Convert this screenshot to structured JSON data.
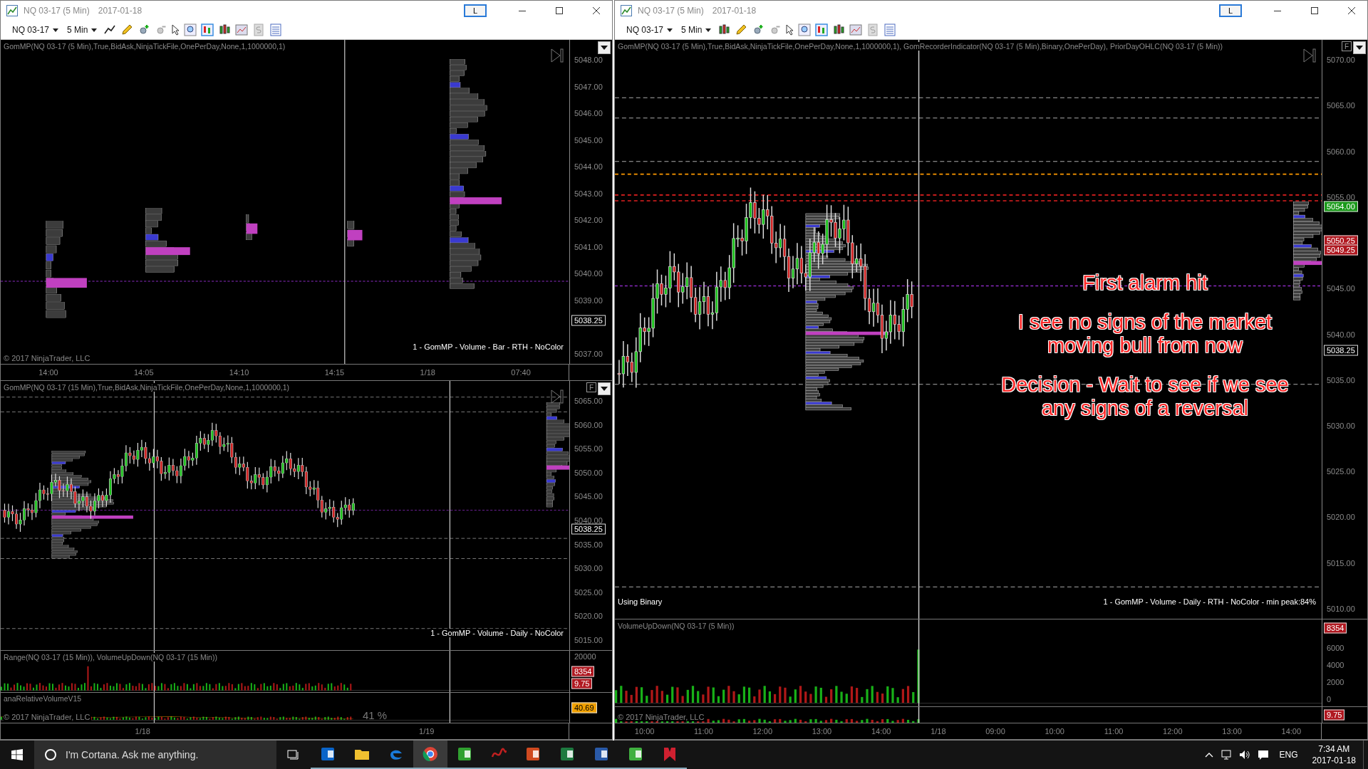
{
  "windows": [
    {
      "title": "NQ 03-17 (5 Min)",
      "date": "2017-01-18",
      "layout_button": "L",
      "toolbar": {
        "instrument": "NQ 03-17",
        "interval": "5 Min"
      },
      "panes": [
        {
          "kind": "profile",
          "label": "GomMP(NQ 03-17 (5 Min),True,BidAsk,NinjaTickFile,OnePerDay,None,1,1000000,1)",
          "legend": "1 - GomMP - Volume - Bar - RTH - NoColor",
          "copyright": "© 2017 NinjaTrader, LLC",
          "axis": [
            "5048.00",
            "5047.00",
            "5046.00",
            "5045.00",
            "5044.00",
            "5043.00",
            "5042.00",
            "5041.00",
            "5040.00",
            "5039.00",
            "5037.00"
          ],
          "markers": [
            {
              "value": "5038.25",
              "color": "#000000"
            }
          ]
        },
        {
          "kind": "time",
          "labels": [
            "14:00",
            "14:05",
            "14:10",
            "14:15",
            "1/18",
            "07:40"
          ]
        },
        {
          "kind": "price",
          "label": "GomMP(NQ 03-17 (15 Min),True,BidAsk,NinjaTickFile,OnePerDay,None,1,1000000,1)",
          "legend": "1 - GomMP - Volume - Daily - NoColor",
          "f_button": "F",
          "axis": [
            "5065.00",
            "5060.00",
            "5055.00",
            "5050.00",
            "5045.00",
            "5040.00",
            "5035.00",
            "5030.00",
            "5025.00",
            "5020.00",
            "5015.00"
          ],
          "markers": [
            {
              "value": "5038.25",
              "color": "#000000"
            }
          ]
        },
        {
          "kind": "volume",
          "label": "Range(NQ 03-17 (15 Min)), VolumeUpDown(NQ 03-17 (15 Min))",
          "axis": [
            "20000"
          ],
          "markers": [
            {
              "value": "8354",
              "color": "#b01820"
            },
            {
              "value": "9.75",
              "color": "#b01820"
            }
          ]
        },
        {
          "kind": "relvol",
          "label": "anaRelativeVolumeV15",
          "copyright": "© 2017 NinjaTrader, LLC",
          "percent": "41 %",
          "markers": [
            {
              "value": "40.69",
              "color": "#f0a000"
            }
          ]
        },
        {
          "kind": "time",
          "labels": [
            "1/18",
            "1/19"
          ]
        }
      ]
    },
    {
      "title": "NQ 03-17 (5 Min)",
      "date": "2017-01-18",
      "layout_button": "L",
      "toolbar": {
        "instrument": "NQ 03-17",
        "interval": "5 Min"
      },
      "panes": [
        {
          "kind": "price",
          "label": "GomMP(NQ 03-17 (5 Min),True,BidAsk,NinjaTickFile,OnePerDay,None,1,1000000,1), GomRecorderIndicator(NQ 03-17 (5 Min),Binary,OnePerDay), PriorDayOHLC(NQ 03-17 (5 Min))",
          "legend": "1 - GomMP - Volume - Daily - RTH - NoColor - min peak:84%",
          "note": "Using Binary",
          "f_button": "F",
          "axis": [
            "5070.00",
            "5065.00",
            "5060.00",
            "5055.00",
            "5045.00",
            "5040.00",
            "5035.00",
            "5030.00",
            "5025.00",
            "5020.00",
            "5015.00",
            "5010.00"
          ],
          "markers": [
            {
              "value": "5054.00",
              "color": "#1a9a1a"
            },
            {
              "value": "5050.25",
              "color": "#b01820"
            },
            {
              "value": "5049.25",
              "color": "#b01820"
            },
            {
              "value": "5038.25",
              "color": "#000000"
            }
          ]
        },
        {
          "kind": "volume",
          "label": "VolumeUpDown(NQ 03-17 (5 Min))",
          "axis": [
            "6000",
            "4000",
            "2000",
            "0"
          ],
          "markers": [
            {
              "value": "8354",
              "color": "#b01820"
            }
          ]
        },
        {
          "kind": "range",
          "copyright": "© 2017 NinjaTrader, LLC",
          "markers": [
            {
              "value": "9.75",
              "color": "#b01820"
            }
          ]
        },
        {
          "kind": "time",
          "labels": [
            "10:00",
            "11:00",
            "12:00",
            "13:00",
            "14:00",
            "1/18",
            "09:00",
            "10:00",
            "11:00",
            "12:00",
            "13:00",
            "14:00"
          ]
        }
      ]
    }
  ],
  "annotations": [
    "First alarm hit",
    "I see no signs of the market moving bull from now",
    "Decision - Wait to see if we see any signs of a reversal"
  ],
  "taskbar": {
    "search": {
      "placeholder": "I'm Cortana. Ask me anything."
    },
    "language": "ENG",
    "time": "7:34 AM",
    "date": "2017-01-18"
  }
}
